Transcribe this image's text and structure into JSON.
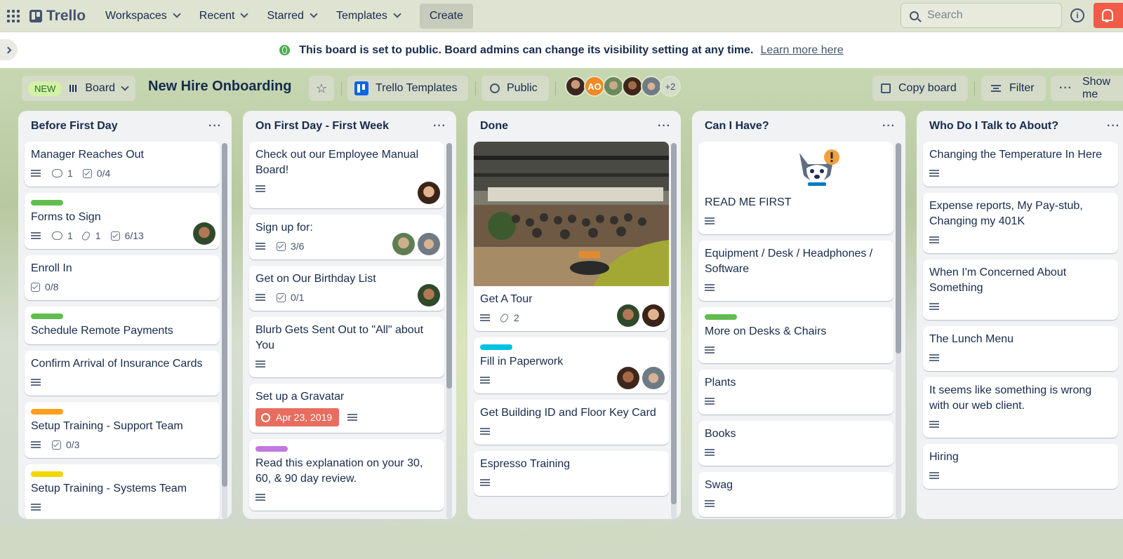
{
  "topbar": {
    "brand": "Trello",
    "nav": [
      {
        "label": "Workspaces"
      },
      {
        "label": "Recent"
      },
      {
        "label": "Starred"
      },
      {
        "label": "Templates"
      }
    ],
    "create_label": "Create",
    "search_placeholder": "Search",
    "info_label": "i"
  },
  "banner": {
    "text": "This board is set to public. Board admins can change its visibility setting at any time.",
    "link": "Learn more here"
  },
  "boardbar": {
    "new_badge": "NEW",
    "view_label": "Board",
    "title": "New Hire Onboarding",
    "template_label": "Trello Templates",
    "visibility_label": "Public",
    "avatar_initials": "AO",
    "more_members": "+2",
    "copy_label": "Copy board",
    "filter_label": "Filter",
    "show_menu_label": "Show me"
  },
  "lists": [
    {
      "title": "Before First Day",
      "cards": [
        {
          "title": "Manager Reaches Out",
          "comments": "1",
          "checklist": "0/4"
        },
        {
          "title": "Forms to Sign",
          "label": "#61bd4f",
          "comments": "1",
          "attachments": "1",
          "checklist": "6/13"
        },
        {
          "title": "Enroll In",
          "checklist": "0/8"
        },
        {
          "title": "Schedule Remote Payments",
          "label": "#61bd4f"
        },
        {
          "title": "Confirm Arrival of Insurance Cards"
        },
        {
          "title": "Setup Training - Support Team",
          "label": "#ff9f1a",
          "checklist": "0/3"
        },
        {
          "title": "Setup Training - Systems Team",
          "label": "#f2d600"
        }
      ]
    },
    {
      "title": "On First Day - First Week",
      "cards": [
        {
          "title": "Check out our Employee Manual Board!"
        },
        {
          "title": "Sign up for:",
          "checklist": "3/6"
        },
        {
          "title": "Get on Our Birthday List",
          "checklist": "0/1"
        },
        {
          "title": "Blurb Gets Sent Out to \"All\" about You"
        },
        {
          "title": "Set up a Gravatar",
          "due": "Apr 23, 2019"
        },
        {
          "title": "Read this explanation on your 30, 60, & 90 day review.",
          "label": "#c377e0"
        }
      ]
    },
    {
      "title": "Done",
      "cards": [
        {
          "title": "Get A Tour",
          "attachments": "2"
        },
        {
          "title": "Fill in Paperwork",
          "label": "#00c2e0"
        },
        {
          "title": "Get Building ID and Floor Key Card"
        },
        {
          "title": "Espresso Training"
        }
      ]
    },
    {
      "title": "Can I Have?",
      "cards": [
        {
          "title": "READ ME FIRST"
        },
        {
          "title": "Equipment / Desk / Headphones / Software"
        },
        {
          "title": "More on Desks & Chairs",
          "label": "#61bd4f"
        },
        {
          "title": "Plants"
        },
        {
          "title": "Books"
        },
        {
          "title": "Swag"
        }
      ]
    },
    {
      "title": "Who Do I Talk to About?",
      "cards": [
        {
          "title": "Changing the Temperature In Here"
        },
        {
          "title": "Expense reports, My Pay-stub, Changing my 401K"
        },
        {
          "title": "When I'm Concerned About Something"
        },
        {
          "title": "The Lunch Menu"
        },
        {
          "title": "It seems like something is wrong with our web client."
        },
        {
          "title": "Hiring"
        }
      ]
    }
  ]
}
